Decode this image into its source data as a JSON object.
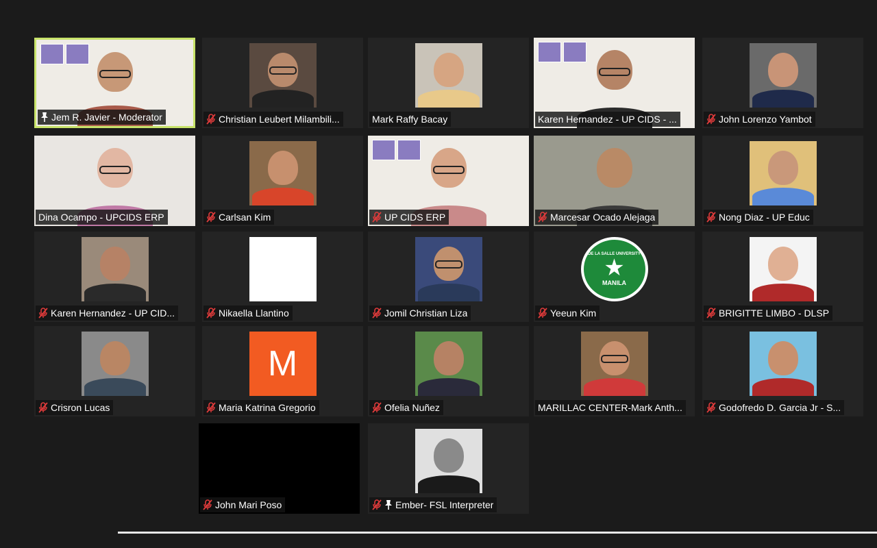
{
  "colors": {
    "background": "#1b1b1b",
    "tile": "#242424",
    "active_speaker_border": "#c8e36a",
    "muted_icon": "#e03b3b"
  },
  "tiles": [
    {
      "name": "Jem R. Javier - Moderator",
      "muted": false,
      "pinned": true,
      "active": true,
      "kind": "logos",
      "bg": "#efece6",
      "skin": "#c79877",
      "shirt": "#a85a4a",
      "glasses": true
    },
    {
      "name": "Christian Leubert Milambili...",
      "muted": true,
      "kind": "center",
      "bg": "#5a4a40",
      "skin": "#b98a6c",
      "shirt": "#222222",
      "glasses": true
    },
    {
      "name": "Mark Raffy Bacay",
      "muted": false,
      "kind": "center",
      "bg": "#c9c3b8",
      "skin": "#d6a582",
      "shirt": "#e8c98a",
      "glasses": false
    },
    {
      "name": "Karen Hernandez - UP CIDS - ...",
      "muted": false,
      "kind": "logos",
      "bg": "#efece6",
      "skin": "#b58466",
      "shirt": "#2a2a2a",
      "glasses": true
    },
    {
      "name": "John Lorenzo Yambot",
      "muted": true,
      "kind": "center",
      "bg": "#6a6a6a",
      "skin": "#c89477",
      "shirt": "#1f2a4a",
      "glasses": false
    },
    {
      "name": "Dina Ocampo - UPCIDS ERP",
      "muted": false,
      "kind": "full",
      "bg": "#e9e6e2",
      "skin": "#e2b7a3",
      "shirt": "#c07aa6",
      "glasses": true
    },
    {
      "name": "Carlsan Kim",
      "muted": true,
      "kind": "center",
      "bg": "#8a6a4a",
      "skin": "#c7906e",
      "shirt": "#d8452a",
      "glasses": false
    },
    {
      "name": "UP CIDS ERP",
      "muted": true,
      "kind": "logos",
      "bg": "#efece6",
      "skin": "#d8a688",
      "shirt": "#c98a8a",
      "glasses": true
    },
    {
      "name": "Marcesar Ocado Alejaga",
      "muted": true,
      "kind": "full",
      "bg": "#9a9a8e",
      "skin": "#b98a66",
      "shirt": "#3a3a3a",
      "glasses": false
    },
    {
      "name": "Nong Diaz - UP Educ",
      "muted": true,
      "kind": "center",
      "bg": "#e0c07a",
      "skin": "#c9987a",
      "shirt": "#5a8ad8",
      "glasses": false
    },
    {
      "name": "Karen Hernandez - UP CID...",
      "muted": true,
      "kind": "center",
      "bg": "#9a8a7a",
      "skin": "#b68266",
      "shirt": "#2a2a2a",
      "glasses": false
    },
    {
      "name": "Nikaella Llantino",
      "muted": true,
      "kind": "blank",
      "bg": "#ffffff"
    },
    {
      "name": "Jomil Christian Liza",
      "muted": true,
      "kind": "center",
      "bg": "#3a4a7a",
      "skin": "#c0906e",
      "shirt": "#2a3a5a",
      "glasses": true
    },
    {
      "name": "Yeeun Kim",
      "muted": true,
      "kind": "seal",
      "seal_top": "DE LA SALLE UNIVERSITY",
      "seal_bottom": "MANILA"
    },
    {
      "name": "BRIGITTE LIMBO - DLSP",
      "muted": true,
      "kind": "center",
      "bg": "#f4f4f4",
      "skin": "#e0b094",
      "shirt": "#b02a2a",
      "glasses": false
    },
    {
      "name": "Crisron Lucas",
      "muted": true,
      "kind": "center",
      "bg": "#8a8a8a",
      "skin": "#b98664",
      "shirt": "#3a4a5a",
      "glasses": false
    },
    {
      "name": "Maria Katrina Gregorio",
      "muted": true,
      "kind": "initial",
      "initial": "M"
    },
    {
      "name": "Ofelia Nuñez",
      "muted": true,
      "kind": "center",
      "bg": "#5a8a4a",
      "skin": "#b68264",
      "shirt": "#2a2a3a",
      "glasses": false
    },
    {
      "name": "MARILLAC CENTER-Mark Anth...",
      "muted": false,
      "kind": "center",
      "bg": "#8a6a4a",
      "skin": "#c8906e",
      "shirt": "#d03a3a",
      "glasses": true
    },
    {
      "name": "Godofredo D. Garcia Jr - S...",
      "muted": true,
      "kind": "center",
      "bg": "#7ac0e0",
      "skin": "#c8906e",
      "shirt": "#b02a2a",
      "glasses": false
    },
    {
      "name": "John Mari Poso",
      "muted": true,
      "kind": "black",
      "bg": "#000000"
    },
    {
      "name": "Ember- FSL Interpreter",
      "muted": true,
      "pinned": true,
      "kind": "center",
      "bg": "#e0e0e0",
      "skin": "#8a8a8a",
      "shirt": "#1a1a1a",
      "glasses": false
    }
  ]
}
